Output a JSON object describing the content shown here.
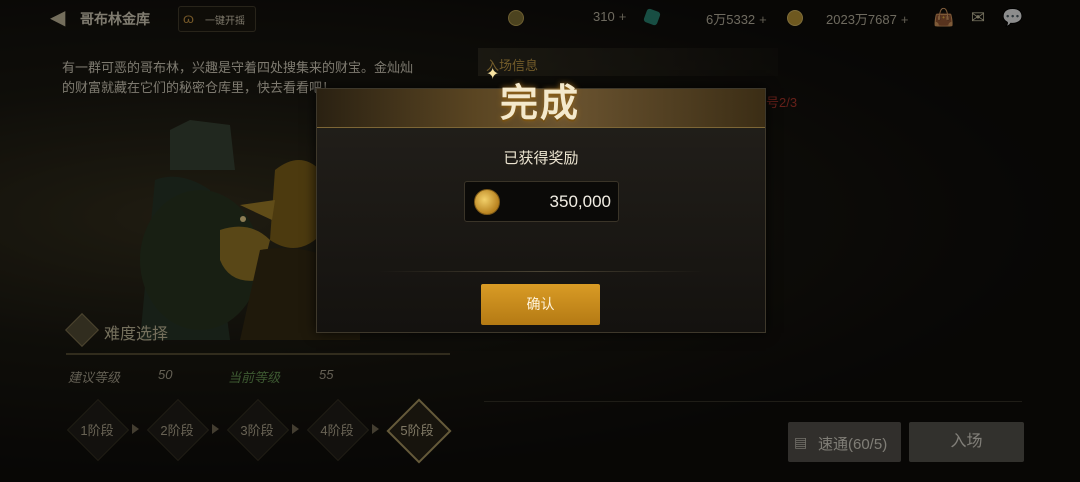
{
  "header": {
    "title": "哥布林金库",
    "one_key_label": "一键开摇",
    "resources": [
      {
        "icon": "coin-c-icon",
        "value": "310"
      },
      {
        "icon": "green-crystal-icon",
        "value": "6万5332"
      },
      {
        "icon": "gold-coin-icon",
        "value": "2023万7687"
      }
    ],
    "plus": "+"
  },
  "description": "有一群可恶的哥布林，兴趣是守着四处搜集来的财宝。金灿灿的财富就藏在它们的秘密仓库里，快去看看吧！",
  "entry_info": {
    "title": "入场信息",
    "fragment": "号2/3"
  },
  "difficulty": {
    "title": "难度选择",
    "suggested_label": "建议等级",
    "suggested_value": "50",
    "current_label": "当前等级",
    "current_value": "55",
    "stages": [
      "1阶段",
      "2阶段",
      "3阶段",
      "4阶段",
      "5阶段"
    ],
    "active_stage": 5
  },
  "buttons": {
    "quick": "速通(60/5)",
    "enter": "入场"
  },
  "modal": {
    "title": "完成",
    "subtitle": "已获得奖励",
    "reward_amount": "350,000",
    "confirm": "确认"
  },
  "colors": {
    "accent": "#d99b25",
    "gold_text": "#cfa64c",
    "green_text": "#6fa35a"
  }
}
